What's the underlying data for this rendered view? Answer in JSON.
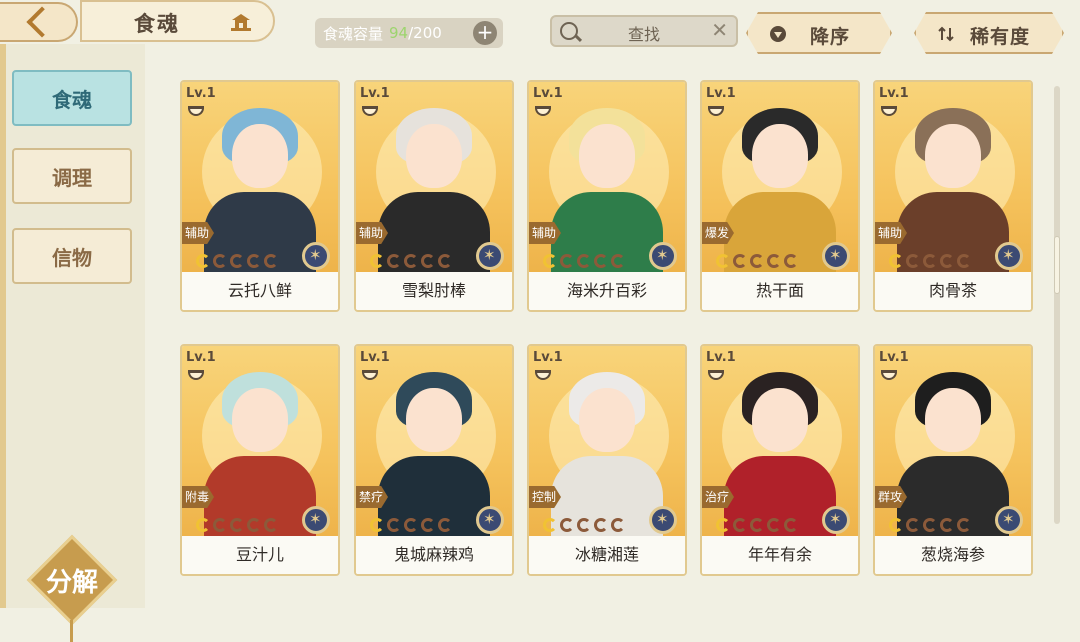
{
  "header": {
    "title": "食魂",
    "capacity_label": "食魂容量",
    "capacity_current": "94",
    "capacity_max": "/200",
    "search_label": "查找",
    "sort_desc_label": "降序",
    "sort_rarity_label": "稀有度"
  },
  "sidebar": {
    "tabs": [
      {
        "label": "食魂",
        "active": true
      },
      {
        "label": "调理",
        "active": false
      },
      {
        "label": "信物",
        "active": false
      }
    ],
    "decompose_label": "分解"
  },
  "cards": [
    {
      "level": "Lv.1",
      "role": "辅助",
      "name": "云托八鲜",
      "hair": "#7fb6d6",
      "outfit": "#2f3a48"
    },
    {
      "level": "Lv.1",
      "role": "辅助",
      "name": "雪梨肘棒",
      "hair": "#e6e2dc",
      "outfit": "#2a2a2a"
    },
    {
      "level": "Lv.1",
      "role": "辅助",
      "name": "海米升百彩",
      "hair": "#f3e19a",
      "outfit": "#2e7d4a"
    },
    {
      "level": "Lv.1",
      "role": "爆发",
      "name": "热干面",
      "hair": "#2a2a2a",
      "outfit": "#d9a53a"
    },
    {
      "level": "Lv.1",
      "role": "辅助",
      "name": "肉骨茶",
      "hair": "#8a7058",
      "outfit": "#6b3f2a"
    },
    {
      "level": "Lv.1",
      "role": "附毒",
      "name": "豆汁儿",
      "hair": "#bfe0dc",
      "outfit": "#b23a2a"
    },
    {
      "level": "Lv.1",
      "role": "禁疗",
      "name": "鬼城麻辣鸡",
      "hair": "#2f4a5a",
      "outfit": "#1f2f3a"
    },
    {
      "level": "Lv.1",
      "role": "控制",
      "name": "冰糖湘莲",
      "hair": "#eceae8",
      "outfit": "#e6e3dc"
    },
    {
      "level": "Lv.1",
      "role": "治疗",
      "name": "年年有余",
      "hair": "#2a2222",
      "outfit": "#b0212a"
    },
    {
      "level": "Lv.1",
      "role": "群攻",
      "name": "葱烧海参",
      "hair": "#1e1e1e",
      "outfit": "#2b2b2b"
    }
  ]
}
